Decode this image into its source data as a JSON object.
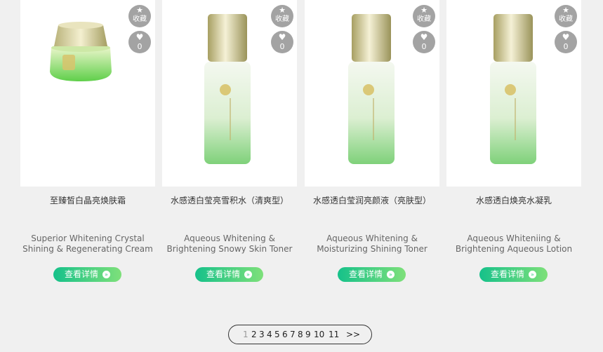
{
  "fav_label": "收藏",
  "detail_label": "查看详情",
  "arrow_glyph": "»",
  "products": [
    {
      "name_cn": "至臻皙白晶亮焕肤霜",
      "name_en_1": "Superior Whitening Crystal",
      "name_en_2": "Shining & Regenerating Cream",
      "likes": "0",
      "kind": "jar"
    },
    {
      "name_cn": "水感透白莹亮雪积水（清爽型）",
      "name_en_1": "Aqueous Whitening &",
      "name_en_2": "Brightening Snowy Skin Toner",
      "likes": "0",
      "kind": "bottle"
    },
    {
      "name_cn": "水感透白莹润亮颜液（亮肤型）",
      "name_en_1": "Aqueous Whitening &",
      "name_en_2": "Moisturizing Shining Toner",
      "likes": "0",
      "kind": "bottle"
    },
    {
      "name_cn": "水感透白焕亮水凝乳",
      "name_en_1": "Aqueous Whiteniing &",
      "name_en_2": "Brightening Aqueous Lotion",
      "likes": "0",
      "kind": "bottle"
    }
  ],
  "pagination": {
    "pages": [
      "1",
      "2",
      "3",
      "4",
      "5",
      "6",
      "7",
      "8",
      "9",
      "10",
      "11"
    ],
    "current": "1",
    "next_label": ">>"
  },
  "colors": {
    "button_gradient_start": "#16c18a",
    "button_gradient_end": "#7ee07a",
    "badge_gray": "#a3a3a3",
    "background": "#f0f0f0"
  }
}
